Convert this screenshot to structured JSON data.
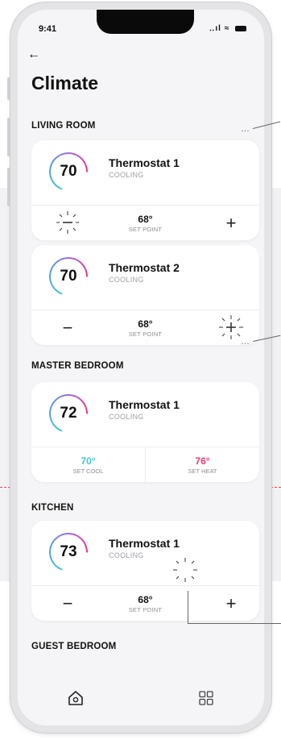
{
  "status_bar": {
    "time": "9:41",
    "signal": "‥ıl"
  },
  "header": {
    "back_icon": "arrow-left-icon",
    "back_glyph": "←",
    "title": "Climate"
  },
  "rooms": [
    {
      "name": "LIVING ROOM",
      "thermostats": [
        {
          "name": "Thermostat 1",
          "status": "COOLING",
          "current_temp": "70",
          "set_point": "68°",
          "set_point_label": "SET POINT",
          "left_control": "minus-burst",
          "right_control": "+"
        },
        {
          "name": "Thermostat 2",
          "status": "COOLING",
          "current_temp": "70",
          "set_point": "68°",
          "set_point_label": "SET POINT",
          "left_control": "−",
          "right_control": "plus-burst"
        }
      ]
    },
    {
      "name": "MASTER BEDROOM",
      "thermostats": [
        {
          "name": "Thermostat 1",
          "status": "COOLING",
          "current_temp": "72",
          "set_cool": "70°",
          "set_cool_label": "SET COOL",
          "set_heat": "76°",
          "set_heat_label": "SET HEAT"
        }
      ]
    },
    {
      "name": "KITCHEN",
      "thermostats": [
        {
          "name": "Thermostat 1",
          "status": "COOLING",
          "current_temp": "73",
          "set_point": "68°",
          "set_point_label": "SET POINT",
          "left_control": "−",
          "right_control": "+"
        }
      ]
    },
    {
      "name": "GUEST BEDROOM",
      "thermostats": []
    }
  ],
  "annotations": {
    "more_dots": "…"
  },
  "tab_bar": {
    "items": [
      {
        "icon": "home-icon"
      },
      {
        "icon": "grid-icon"
      }
    ]
  },
  "colors": {
    "cool": "#3fc6d6",
    "heat": "#e83a6e",
    "accent_dash": "#e0485a"
  }
}
